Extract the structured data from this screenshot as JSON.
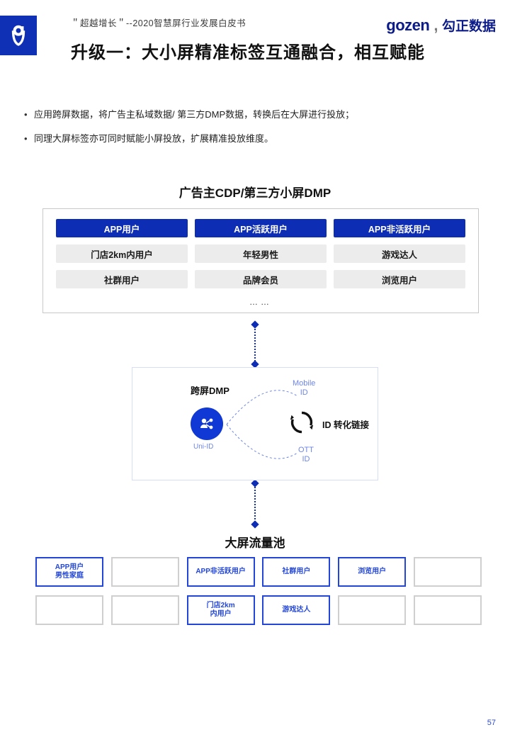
{
  "header": {
    "doc_subtitle": "＂超越增长＂--2020智慧屏行业发展白皮书",
    "brand_en": "gozen",
    "brand_dot": ",",
    "brand_cn": "勾正数据"
  },
  "title": "升级一：大小屏精准标签互通融合，相互赋能",
  "bullets": [
    "应用跨屏数据，将广告主私域数据/ 第三方DMP数据，转换后在大屏进行投放；",
    "同理大屏标签亦可同时赋能小屏投放，扩展精准投放维度。"
  ],
  "cdp": {
    "title": "广告主CDP/第三方小屏DMP",
    "rows": [
      {
        "style": "blue",
        "items": [
          "APP用户",
          "APP活跃用户",
          "APP非活跃用户"
        ]
      },
      {
        "style": "gray",
        "items": [
          "门店2km内用户",
          "年轻男性",
          "游戏达人"
        ]
      },
      {
        "style": "gray",
        "items": [
          "社群用户",
          "品牌会员",
          "浏览用户"
        ]
      }
    ],
    "ellipsis": "……"
  },
  "dmp": {
    "label": "跨屏DMP",
    "mobile_id_l1": "Mobile",
    "mobile_id_l2": "ID",
    "ott_id_l1": "OTT",
    "ott_id_l2": "ID",
    "uni_label": "Uni-ID",
    "convert_label": "ID 转化链接"
  },
  "pool": {
    "title": "大屏流量池",
    "rows": [
      [
        {
          "style": "blue",
          "text": "APP用户\n男性家庭"
        },
        {
          "style": "gray",
          "text": ""
        },
        {
          "style": "blue",
          "text": "APP非活跃用户"
        },
        {
          "style": "blue",
          "text": "社群用户"
        },
        {
          "style": "blue",
          "text": "浏览用户"
        },
        {
          "style": "gray",
          "text": ""
        }
      ],
      [
        {
          "style": "gray",
          "text": ""
        },
        {
          "style": "gray",
          "text": ""
        },
        {
          "style": "blue",
          "text": "门店2km\n内用户"
        },
        {
          "style": "blue",
          "text": "游戏达人"
        },
        {
          "style": "gray",
          "text": ""
        },
        {
          "style": "gray",
          "text": ""
        }
      ]
    ]
  },
  "page_number": "57"
}
